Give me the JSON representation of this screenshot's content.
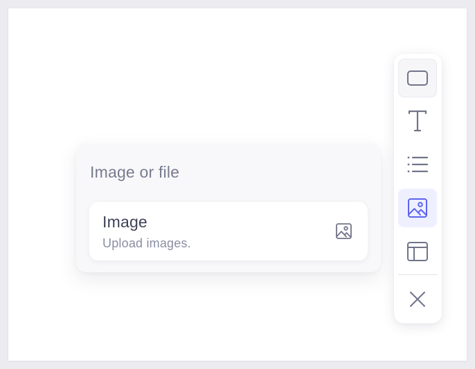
{
  "panel": {
    "title": "Image or file",
    "option": {
      "title": "Image",
      "description": "Upload images.",
      "icon": "image-icon"
    }
  },
  "toolbar": {
    "tools": [
      {
        "name": "box",
        "icon": "rectangle-icon",
        "selected": false
      },
      {
        "name": "text",
        "icon": "text-icon",
        "selected": false
      },
      {
        "name": "list",
        "icon": "list-icon",
        "selected": false
      },
      {
        "name": "image",
        "icon": "image-icon",
        "selected": true
      },
      {
        "name": "layout",
        "icon": "layout-icon",
        "selected": false
      },
      {
        "name": "close",
        "icon": "close-icon",
        "selected": false
      }
    ],
    "accent_color": "#5b63f0",
    "icon_color": "#707489"
  }
}
